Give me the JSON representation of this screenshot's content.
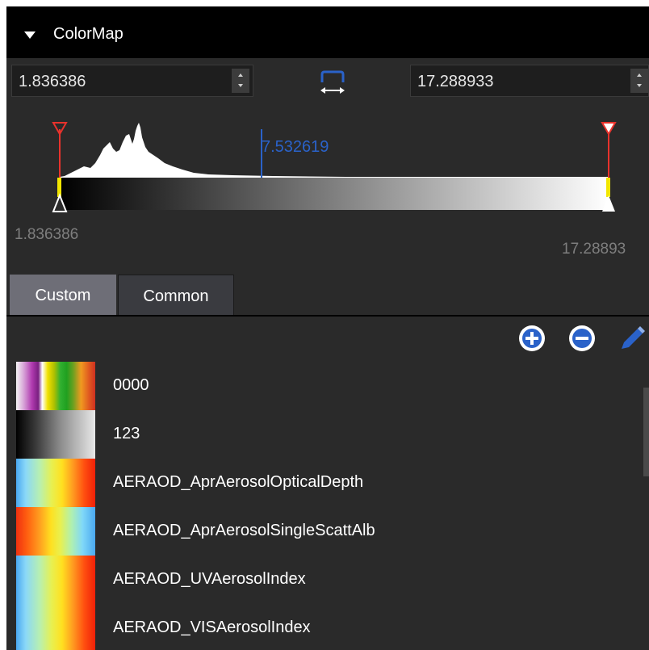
{
  "header": {
    "title": "ColorMap"
  },
  "range": {
    "min_value": "1.836386",
    "max_value": "17.288933",
    "marker_value": "7.532619",
    "min_label": "1.836386",
    "max_label": "17.28893"
  },
  "tabs": [
    {
      "label": "Custom",
      "active": true
    },
    {
      "label": "Common",
      "active": false
    }
  ],
  "toolbar": {
    "add_icon": "plus-circle-icon",
    "remove_icon": "minus-circle-icon",
    "edit_icon": "pencil-icon"
  },
  "colormaps": [
    {
      "name": "0000"
    },
    {
      "name": "123"
    },
    {
      "name": "AERAOD_AprAerosolOpticalDepth"
    },
    {
      "name": "AERAOD_AprAerosolSingleScattAlb"
    },
    {
      "name": "AERAOD_UVAerosolIndex"
    },
    {
      "name": "AERAOD_VISAerosolIndex"
    }
  ],
  "colors": {
    "accent_blue": "#2a62c9",
    "marker_red": "#e8322c",
    "handle_yellow": "#f2e600"
  }
}
